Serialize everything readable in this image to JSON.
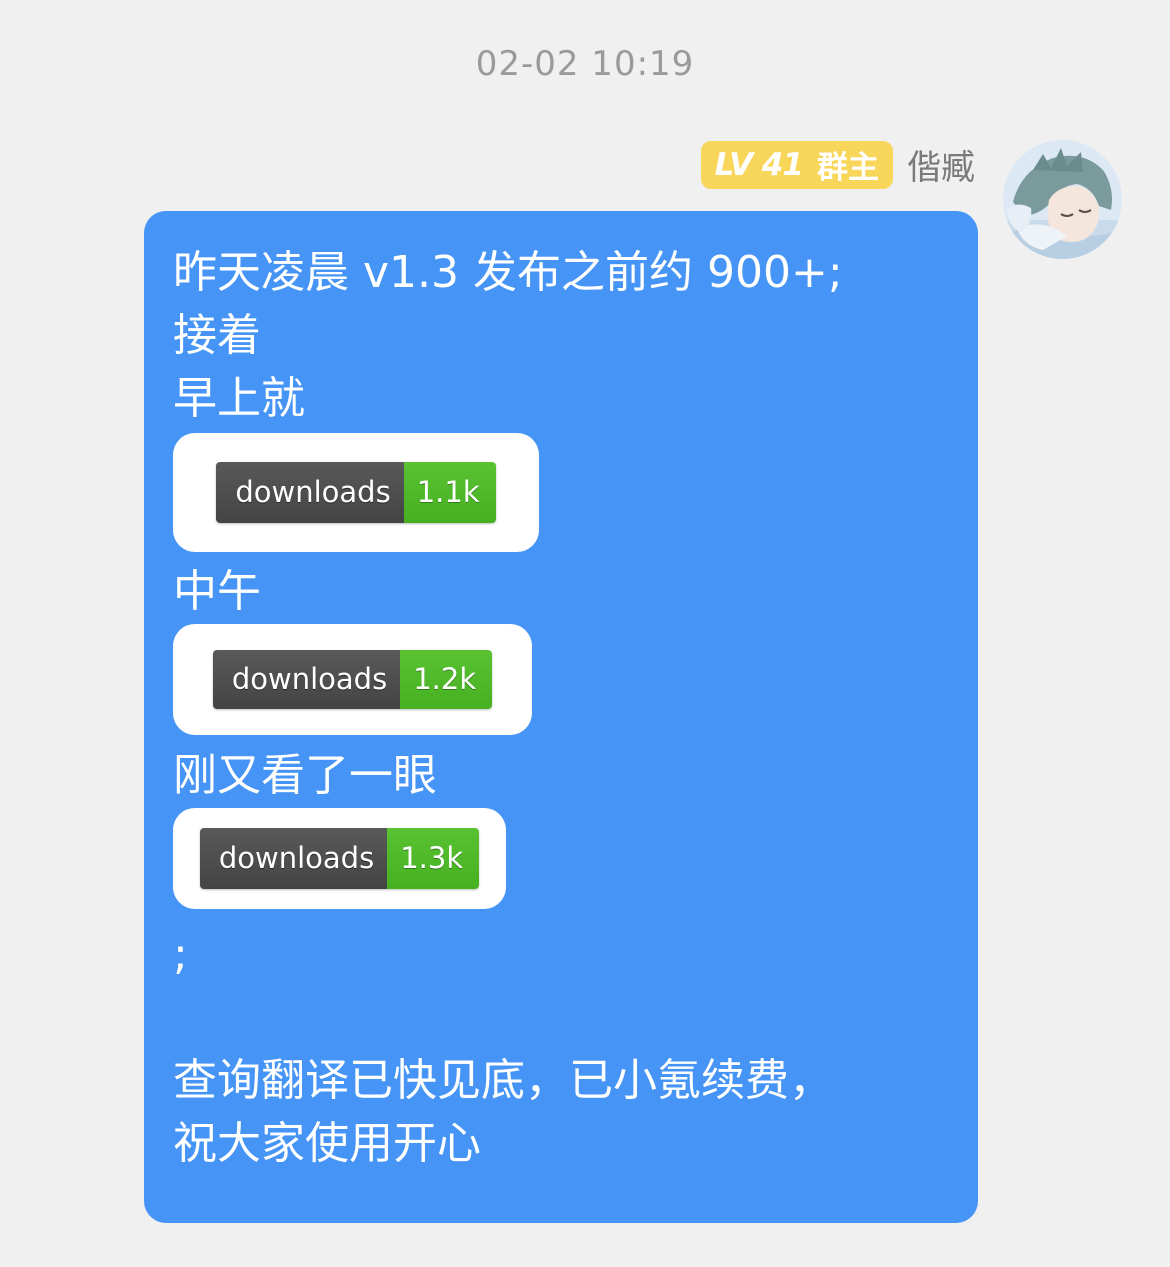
{
  "timestamp": "02-02 10:19",
  "sender": {
    "level": "LV 41",
    "role": "群主",
    "name": "偕臧"
  },
  "message": {
    "line1": "昨天凌晨 v1.3 发布之前约 900+;",
    "line2": "接着",
    "line3": "早上就",
    "badge1": {
      "label": "downloads",
      "value": "1.1k"
    },
    "line4": "中午",
    "badge2": {
      "label": "downloads",
      "value": "1.2k"
    },
    "line5": "刚又看了一眼",
    "badge3": {
      "label": "downloads",
      "value": "1.3k"
    },
    "line6": ";",
    "line7": "查询翻译已快见底，已小氪续费，",
    "line8": "祝大家使用开心"
  },
  "colors": {
    "bubble": "#4695f6",
    "badge": "#f8d65a",
    "shield_label": "#4f4f4f",
    "shield_value": "#4fba2a"
  },
  "icons": {
    "avatar": "anime-boy-sleeping-avatar"
  }
}
